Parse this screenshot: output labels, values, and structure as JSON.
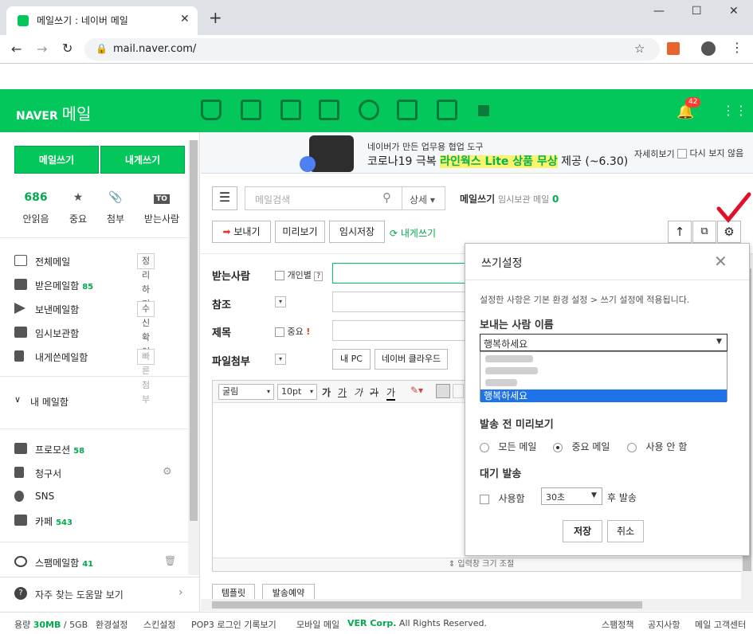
{
  "browser": {
    "tab_title": "메일쓰기 : 네이버 메일",
    "url": "mail.naver.com/"
  },
  "header": {
    "logo_naver": "NAVER",
    "logo_mail": "메일",
    "notif_count": "42",
    "brand_color": "#03c75a"
  },
  "sidebar": {
    "write_button": "메일쓰기",
    "self_write_button": "내게쓰기",
    "stats": [
      {
        "count": "686",
        "label": "안읽음"
      },
      {
        "count": "",
        "label": "중요"
      },
      {
        "count": "",
        "label": "첨부"
      },
      {
        "count": "",
        "label": "받는사람"
      }
    ],
    "to_icon": "TO",
    "folders": [
      {
        "label": "전체메일",
        "count": "",
        "button": "정리하기",
        "icon": "envelope-icon"
      },
      {
        "label": "받은메일함",
        "count": "85",
        "button": "",
        "icon": "inbox-icon"
      },
      {
        "label": "보낸메일함",
        "count": "",
        "button": "수신확인",
        "icon": "send-icon"
      },
      {
        "label": "임시보관함",
        "count": "",
        "button": "",
        "icon": "folder-icon"
      },
      {
        "label": "내게쓴메일함",
        "count": "",
        "button": "빠른첨부",
        "icon": "note-icon"
      }
    ],
    "my_mailbox": "내 메일함",
    "categories": [
      {
        "label": "프로모션",
        "count": "58",
        "icon": "shop-icon"
      },
      {
        "label": "청구서",
        "count": "",
        "icon": "bill-icon"
      },
      {
        "label": "SNS",
        "count": "",
        "icon": "share-icon"
      },
      {
        "label": "카페",
        "count": "543",
        "icon": "cup-icon"
      }
    ],
    "spam": {
      "label": "스팸메일함",
      "count": "41"
    },
    "help": "자주 찾는 도움말 보기"
  },
  "banner": {
    "line1": "네이버가 만든 업무용 협업 도구",
    "line2_pre": "코로나19 극복 ",
    "line2_highlight": "라인웍스 Lite 상품 무상",
    "line2_post": " 제공 (~6.30)",
    "detail": "자세히보기",
    "dismiss": "다시 보지 않음"
  },
  "toolbar": {
    "search_placeholder": "메일검색",
    "detail_label": "상세",
    "mode_label": "메일쓰기",
    "temp_label": "임시보관 메일",
    "temp_count": "0",
    "send": "보내기",
    "preview": "미리보기",
    "save_temp": "임시저장",
    "self_write": "내게쓰기"
  },
  "form": {
    "to_label": "받는사람",
    "individual": "개인별",
    "help": "?",
    "cc_label": "참조",
    "subject_label": "제목",
    "important": "중요",
    "important_mark": "!",
    "attach_label": "파일첨부",
    "my_pc": "내 PC",
    "naver_cloud": "네이버 클라우드"
  },
  "editor": {
    "font": "굴림",
    "size": "10pt",
    "bold": "가",
    "underline": "가",
    "italic": "가",
    "strike": "가",
    "color": "가",
    "resize": "입력창 크기 조절",
    "template": "템플릿",
    "schedule": "발송예약"
  },
  "popup": {
    "title": "쓰기설정",
    "info": "설정한 사항은 기본 환경 설정 > 쓰기 설정에 적용됩니다.",
    "sender_title": "보내는 사람 이름",
    "sender_selected": "행복하세요",
    "sender_options": [
      "행복하세요"
    ],
    "preview_title": "발송 전 미리보기",
    "preview_options": [
      "모든 메일",
      "중요 메일",
      "사용 안 함"
    ],
    "preview_selected": 1,
    "delay_title": "대기 발송",
    "delay_use": "사용함",
    "delay_value": "30초",
    "delay_suffix": "후 발송",
    "save": "저장",
    "cancel": "취소"
  },
  "footer": {
    "usage_label": "용량",
    "usage_value": "30MB",
    "usage_total": "/ 5GB",
    "links": [
      "환경설정",
      "스킨설정",
      "POP3 로그인 기록보기",
      "모바일 메일"
    ],
    "copyright_brand": "VER Corp.",
    "copyright": " All Rights Reserved.",
    "right_links": [
      "스팸정책",
      "공지사항",
      "메일 고객센터"
    ]
  }
}
